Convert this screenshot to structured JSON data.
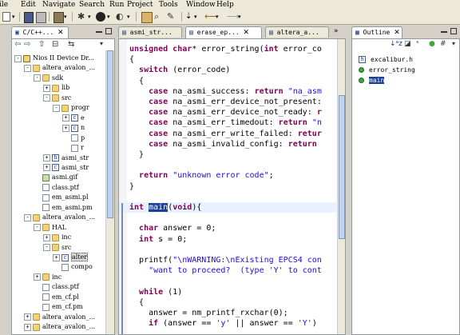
{
  "menu": [
    "ile",
    "Edit",
    "Navigate",
    "Search",
    "Run",
    "Project",
    "Tools",
    "Window",
    "Help"
  ],
  "left_tabs": {
    "active": "C/C++...",
    "close": "✕"
  },
  "editor_tabs": [
    {
      "label": "asmi_str...",
      "active": false
    },
    {
      "label": "erase_ep...",
      "active": true
    },
    {
      "label": "altera_a...",
      "active": false
    }
  ],
  "right_tabs": {
    "active": "Outline"
  },
  "tree": [
    {
      "indent": 0,
      "exp": "−",
      "icon": "proj",
      "label": "Nios II Device Dr..."
    },
    {
      "indent": 1,
      "exp": "−",
      "icon": "folder",
      "label": "altera_avalon_..."
    },
    {
      "indent": 2,
      "exp": "−",
      "icon": "folder",
      "label": "sdk"
    },
    {
      "indent": 3,
      "exp": "+",
      "icon": "folder",
      "label": "lib"
    },
    {
      "indent": 3,
      "exp": "−",
      "icon": "folder",
      "label": "src"
    },
    {
      "indent": 4,
      "exp": "−",
      "icon": "folder",
      "label": "progr"
    },
    {
      "indent": 5,
      "exp": "+",
      "icon": "cfile",
      "label": "e"
    },
    {
      "indent": 5,
      "exp": "+",
      "icon": "cfile",
      "label": "n"
    },
    {
      "indent": 5,
      "exp": "",
      "icon": "file",
      "label": "p"
    },
    {
      "indent": 5,
      "exp": "",
      "icon": "file",
      "label": "r"
    },
    {
      "indent": 3,
      "exp": "+",
      "icon": "hfile",
      "label": "asmi_str"
    },
    {
      "indent": 3,
      "exp": "+",
      "icon": "cfile",
      "label": "asmi_str"
    },
    {
      "indent": 2,
      "exp": "",
      "icon": "img",
      "label": "asmi.gif"
    },
    {
      "indent": 2,
      "exp": "",
      "icon": "file",
      "label": "class.ptf"
    },
    {
      "indent": 2,
      "exp": "",
      "icon": "file",
      "label": "em_asmi.pl"
    },
    {
      "indent": 2,
      "exp": "",
      "icon": "file",
      "label": "em_asmi.pm"
    },
    {
      "indent": 1,
      "exp": "−",
      "icon": "folder",
      "label": "altera_avalon_..."
    },
    {
      "indent": 2,
      "exp": "−",
      "icon": "folder",
      "label": "HAL"
    },
    {
      "indent": 3,
      "exp": "+",
      "icon": "folder",
      "label": "inc"
    },
    {
      "indent": 3,
      "exp": "−",
      "icon": "folder",
      "label": "src"
    },
    {
      "indent": 4,
      "exp": "+",
      "icon": "cfile",
      "label": "alter",
      "selected": true
    },
    {
      "indent": 4,
      "exp": "",
      "icon": "file",
      "label": "compo"
    },
    {
      "indent": 2,
      "exp": "+",
      "icon": "folder",
      "label": "inc"
    },
    {
      "indent": 2,
      "exp": "",
      "icon": "file",
      "label": "class.ptf"
    },
    {
      "indent": 2,
      "exp": "",
      "icon": "file",
      "label": "em_cf.pl"
    },
    {
      "indent": 2,
      "exp": "",
      "icon": "file",
      "label": "em_cf.pm"
    },
    {
      "indent": 1,
      "exp": "+",
      "icon": "folder",
      "label": "altera_avalon_..."
    },
    {
      "indent": 1,
      "exp": "+",
      "icon": "folder",
      "label": "altera_avalon_..."
    }
  ],
  "code_lines": [
    {
      "y": 0,
      "html": "<span class=\"kw\">unsigned char</span>* error_string(<span class=\"kw\">int</span> error_co"
    },
    {
      "y": 1,
      "html": "{"
    },
    {
      "y": 2,
      "html": "  <span class=\"kw\">switch</span> (error_code)"
    },
    {
      "y": 3,
      "html": "  {"
    },
    {
      "y": 4,
      "html": "    <span class=\"kw\">case</span> na_asmi_success: <span class=\"kw\">return</span> <span class=\"str\">\"na_asm</span>"
    },
    {
      "y": 5,
      "html": "    <span class=\"kw\">case</span> na_asmi_err_device_not_present: "
    },
    {
      "y": 6,
      "html": "    <span class=\"kw\">case</span> na_asmi_err_device_not_ready: <span class=\"kw\">r</span>"
    },
    {
      "y": 7,
      "html": "    <span class=\"kw\">case</span> na_asmi_err_timedout: <span class=\"kw\">return</span> <span class=\"str\">\"n</span>"
    },
    {
      "y": 8,
      "html": "    <span class=\"kw\">case</span> na_asmi_err_write_failed: <span class=\"kw\">retur</span>"
    },
    {
      "y": 9,
      "html": "    <span class=\"kw\">case</span> na_asmi_invalid_config: <span class=\"kw\">return</span> "
    },
    {
      "y": 10,
      "html": "  }"
    },
    {
      "y": 11,
      "html": ""
    },
    {
      "y": 12,
      "html": "  <span class=\"kw\">return</span> <span class=\"str\">\"unknown error code\"</span>;"
    },
    {
      "y": 13,
      "html": "}"
    },
    {
      "y": 14,
      "html": ""
    },
    {
      "y": 15,
      "html": "<span class=\"kw\">int</span> <span style=\"background:#1c3f94;color:#fff\">main</span>(<span class=\"kw\">void</span>){"
    },
    {
      "y": 16,
      "html": ""
    },
    {
      "y": 17,
      "html": "  <span class=\"kw\">char</span> answer = 0;"
    },
    {
      "y": 18,
      "html": "  <span class=\"kw\">int</span> s = 0;"
    },
    {
      "y": 19,
      "html": ""
    },
    {
      "y": 20,
      "html": "  printf(<span class=\"str\">\"\\nWARNING:\\nExisting EPCS4 con</span>"
    },
    {
      "y": 21,
      "html": "    <span class=\"str\">\"want to proceed?  (type 'Y' to cont</span>"
    },
    {
      "y": 22,
      "html": ""
    },
    {
      "y": 23,
      "html": "  <span class=\"kw\">while</span> (1)"
    },
    {
      "y": 24,
      "html": "  {"
    },
    {
      "y": 25,
      "html": "    answer = nm_printf_rxchar(0);"
    },
    {
      "y": 26,
      "html": "    <span class=\"kw\">if</span> (answer == <span class=\"str\">'y'</span> || answer == <span class=\"str\">'Y'</span>)"
    },
    {
      "y": 27,
      "html": ""
    }
  ],
  "outline": [
    {
      "icon": "include",
      "label": "excalibur.h"
    },
    {
      "icon": "dot",
      "label": "error_string"
    },
    {
      "icon": "dot",
      "label": "main",
      "selected": true
    }
  ]
}
